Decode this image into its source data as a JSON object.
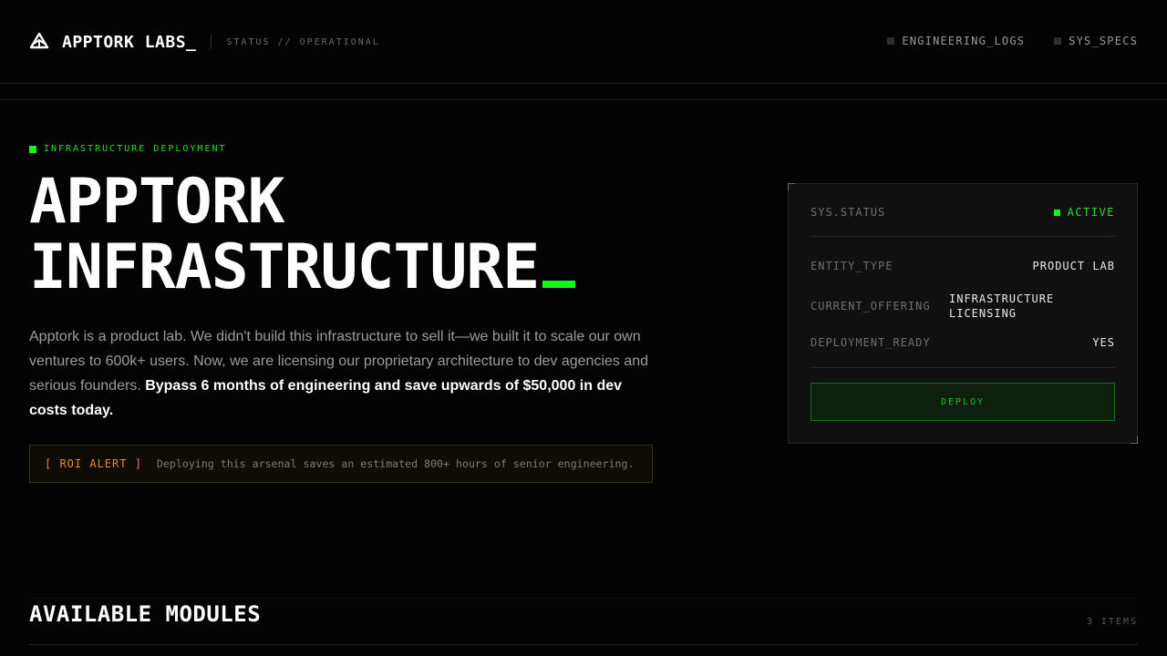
{
  "nav": {
    "brand": "APPTORK LABS_",
    "status": "STATUS // OPERATIONAL",
    "links": [
      "ENGINEERING_LOGS",
      "SYS_SPECS"
    ]
  },
  "hero": {
    "eyebrow": "INFRASTRUCTURE DEPLOYMENT",
    "title_line1": "APPTORK",
    "title_line2": "INFRASTRUCTURE",
    "description": "Apptork is a product lab. We didn't build this infrastructure to sell it—we built it to scale our own ventures to 600k+ users. Now, we are licensing our proprietary architecture to dev agencies and serious founders.",
    "description_emphasis": "Bypass 6 months of engineering and save upwards of $50,000 in dev costs today.",
    "roi_tag": "[ ROI ALERT ]",
    "roi_text": "Deploying this arsenal saves an estimated 800+ hours of senior engineering."
  },
  "panel": {
    "status_key": "SYS.STATUS",
    "status_value": "ACTIVE",
    "rows": [
      {
        "key": "ENTITY_TYPE",
        "value": "PRODUCT LAB"
      },
      {
        "key": "CURRENT_OFFERING",
        "value": "INFRASTRUCTURE LICENSING"
      },
      {
        "key": "DEPLOYMENT_READY",
        "value": "YES"
      }
    ],
    "deploy_label": "DEPLOY"
  },
  "modules": {
    "title": "AVAILABLE MODULES",
    "count": "3 ITEMS"
  },
  "colors": {
    "accent_green": "#17f717",
    "alert_orange": "#f08a1c",
    "background": "#030303"
  }
}
